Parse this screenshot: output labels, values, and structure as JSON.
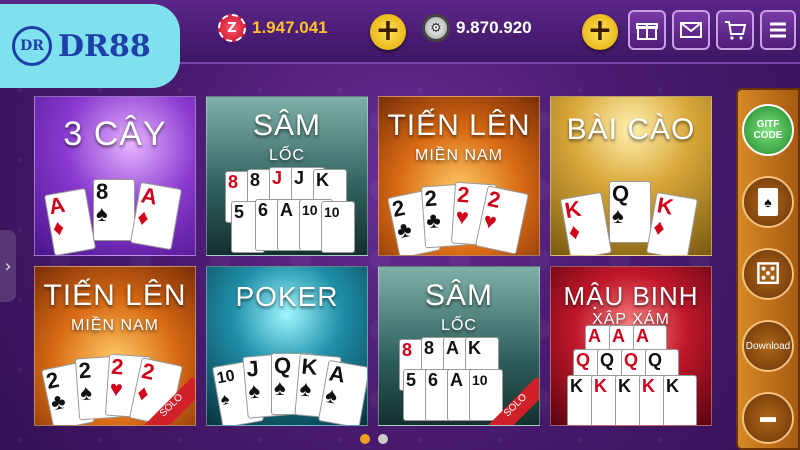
{
  "app": {
    "logo_text": "DR88",
    "logo_mark": "DR"
  },
  "currency": {
    "gold": "1.947.041",
    "silver": "9.870.920",
    "gold_icon": "Z"
  },
  "top_buttons": [
    "gift-icon",
    "mail-icon",
    "cart-icon",
    "menu-icon"
  ],
  "games": [
    {
      "title": "3 CÂY",
      "subtitle": ""
    },
    {
      "title": "SÂM",
      "subtitle": "LỐC"
    },
    {
      "title": "TIẾN LÊN",
      "subtitle": "MIỀN NAM"
    },
    {
      "title": "BÀI CÀO",
      "subtitle": ""
    },
    {
      "title": "TIẾN LÊN",
      "subtitle": "MIỀN NAM",
      "badge": "SOLO"
    },
    {
      "title": "POKER",
      "subtitle": ""
    },
    {
      "title": "SÂM",
      "subtitle": "LỐC",
      "badge": "SOLO"
    },
    {
      "title": "MẬU BINH",
      "subtitle": "XẬP XÁM"
    }
  ],
  "side": {
    "gift_code_line1": "GITF",
    "gift_code_line2": "CODE",
    "download": "Download"
  },
  "pager": {
    "count": 2,
    "active": 0
  },
  "colors": {
    "accent": "#f0a020",
    "gold_text": "#ffc12a",
    "silver_text": "#ffffff"
  }
}
